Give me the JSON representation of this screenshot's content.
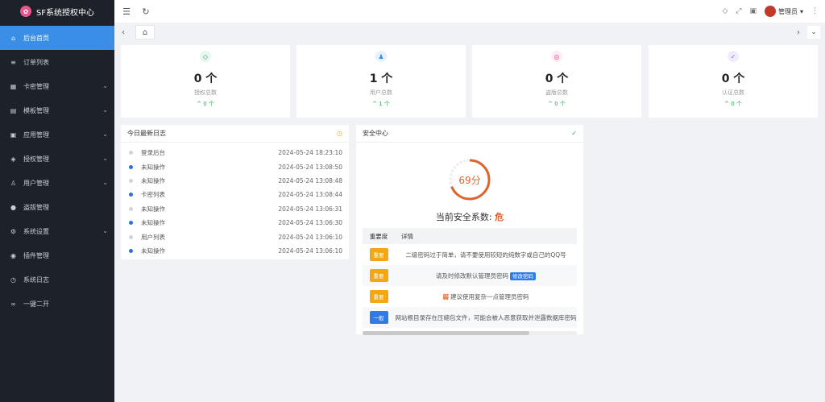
{
  "app": {
    "title": "SF系统授权中心"
  },
  "sidebar": {
    "items": [
      {
        "label": "后台首页",
        "icon": "home-icon",
        "active": true,
        "expandable": false
      },
      {
        "label": "订单列表",
        "icon": "list-icon",
        "active": false,
        "expandable": false
      },
      {
        "label": "卡密管理",
        "icon": "grid-icon",
        "active": false,
        "expandable": true
      },
      {
        "label": "模板管理",
        "icon": "template-icon",
        "active": false,
        "expandable": true
      },
      {
        "label": "应用管理",
        "icon": "app-icon",
        "active": false,
        "expandable": true
      },
      {
        "label": "授权管理",
        "icon": "shield-icon",
        "active": false,
        "expandable": true
      },
      {
        "label": "用户管理",
        "icon": "user-icon",
        "active": false,
        "expandable": true
      },
      {
        "label": "盗版管理",
        "icon": "piracy-icon",
        "active": false,
        "expandable": false
      },
      {
        "label": "系统设置",
        "icon": "gear-icon",
        "active": false,
        "expandable": true
      },
      {
        "label": "插件管理",
        "icon": "plugin-icon",
        "active": false,
        "expandable": false
      },
      {
        "label": "系统日志",
        "icon": "clock-icon",
        "active": false,
        "expandable": false
      },
      {
        "label": "一键二开",
        "icon": "link-icon",
        "active": false,
        "expandable": false
      }
    ]
  },
  "topbar": {
    "user_name": "管理员"
  },
  "stats": [
    {
      "value": "0 个",
      "label": "授权总数",
      "trend": "0 个",
      "icon": "shield-check-icon",
      "color": "#2ea35b",
      "bg": "#e8f7ee"
    },
    {
      "value": "1 个",
      "label": "用户总数",
      "trend": "1 个",
      "icon": "users-icon",
      "color": "#3a8ee6",
      "bg": "#e6f1fc"
    },
    {
      "value": "0 个",
      "label": "盗版总数",
      "trend": "0 个",
      "icon": "target-icon",
      "color": "#e8458d",
      "bg": "#fdecf3"
    },
    {
      "value": "0 个",
      "label": "认证总数",
      "trend": "0 个",
      "icon": "verified-icon",
      "color": "#8e6bdc",
      "bg": "#f1ecfb"
    }
  ],
  "logs": {
    "title": "今日最新日志",
    "items": [
      {
        "action": "登录后台",
        "time": "2024-05-24 18:23:10",
        "dot": "#cfd3da"
      },
      {
        "action": "未知操作",
        "time": "2024-05-24 13:08:50",
        "dot": "#2f6fd6"
      },
      {
        "action": "未知操作",
        "time": "2024-05-24 13:08:48",
        "dot": "#cfd3da"
      },
      {
        "action": "卡密列表",
        "time": "2024-05-24 13:08:44",
        "dot": "#2f6fd6"
      },
      {
        "action": "未知操作",
        "time": "2024-05-24 13:06:31",
        "dot": "#cfd3da"
      },
      {
        "action": "未知操作",
        "time": "2024-05-24 13:06:30",
        "dot": "#2f6fd6"
      },
      {
        "action": "用户列表",
        "time": "2024-05-24 13:06:10",
        "dot": "#cfd3da"
      },
      {
        "action": "未知操作",
        "time": "2024-05-24 13:06:10",
        "dot": "#2f6fd6"
      }
    ]
  },
  "security": {
    "title": "安全中心",
    "score": "69分",
    "score_fraction": 0.69,
    "coef_label": "当前安全系数:",
    "coef_value": "危",
    "col_level": "重要度",
    "col_detail": "详情",
    "rows": [
      {
        "level": "重要",
        "level_type": "warn",
        "detail": "二级密码过于简单，请不要使用较短的纯数字或自己的QQ号",
        "button": "",
        "mark": ""
      },
      {
        "level": "重要",
        "level_type": "warn",
        "detail": "请及时修改默认管理员密码",
        "button": "修改密码",
        "mark": ""
      },
      {
        "level": "重要",
        "level_type": "warn",
        "detail": "建议使用复杂一点管理员密码",
        "button": "",
        "mark": "弱"
      },
      {
        "level": "一般",
        "level_type": "info",
        "detail": "网站根目录存在压缩包文件，可能会被人恶意获取并泄露数据库密码",
        "button": "",
        "mark": ""
      }
    ]
  }
}
